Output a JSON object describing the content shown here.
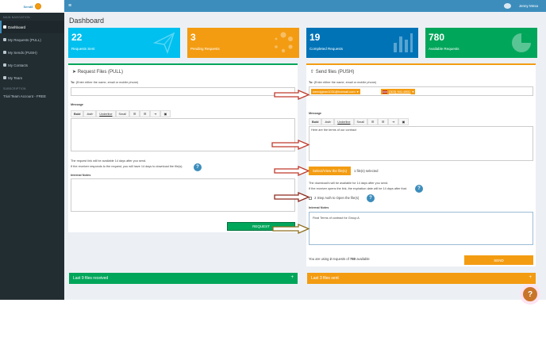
{
  "sidebar": {
    "logo": "Send8",
    "section_label": "MAIN NAVIGATION",
    "items": [
      {
        "label": "Dashboard",
        "icon": "dashboard-icon"
      },
      {
        "label": "My Requests (PULL)",
        "icon": "download-icon"
      },
      {
        "label": "My Sends (PUSH)",
        "icon": "upload-icon"
      },
      {
        "label": "My Contacts",
        "icon": "contacts-icon"
      },
      {
        "label": "My Team",
        "icon": "team-icon"
      }
    ],
    "sub_header": "SUBSCRIPTION",
    "account_label": "Trial Team Account - FREE"
  },
  "topbar": {
    "menu_icon": "≡",
    "user_name": "Jenny Mesa"
  },
  "page": {
    "title": "Dashboard"
  },
  "tiles": [
    {
      "value": "22",
      "label": "Requests Sent",
      "color": "#00c0ef",
      "icon": "paper-plane-icon"
    },
    {
      "value": "3",
      "label": "Pending Requests",
      "color": "#f39c12",
      "icon": "spinner-icon"
    },
    {
      "value": "19",
      "label": "Completed Requests",
      "color": "#0073b7",
      "icon": "bar-chart-icon"
    },
    {
      "value": "780",
      "label": "Available Requests",
      "color": "#00a65a",
      "icon": "pie-chart-icon"
    }
  ],
  "pull": {
    "title": "Request Files (PULL)",
    "to_label": "To:",
    "to_hint": "(Enter either the name, email or mobile phone)",
    "message_label": "Message",
    "toolbar": [
      "Bold",
      "Italic",
      "Underline",
      "Small"
    ],
    "note1": "The request link will be available 14 days after you send.",
    "note2": "If the receiver responds to the request, you will have 14 days to download the file(s).",
    "internal_notes_label": "Internal Notes",
    "request_button": "REQUEST"
  },
  "push": {
    "title": "Send files (PUSH)",
    "to_label": "To:",
    "to_hint": "(Enter either the name, email or mobile phone)",
    "recipient_email": "wendyjean1031@hotmail.com",
    "recipient_phone": "(303) 941-6931",
    "message_label": "Message",
    "toolbar": [
      "Bold",
      "Italic",
      "Underline",
      "Small"
    ],
    "message_text": "Here are the terms of our contract",
    "select_button": "Select/View the file(s)",
    "files_selected": "1 file(s) selected",
    "note1": "The download's will be available for 14 days after you send.",
    "note2": "If the receiver opens the link, the expiration date will be 14 days after that.",
    "two_step_label": "2 Step Auth to Open the file(s)",
    "internal_notes_label": "Internal Notes",
    "internal_notes_text": "Final Terms of contract for Group A",
    "usage_prefix": "You are using",
    "usage_used": "2",
    "usage_middle": "requests of",
    "usage_total": "780",
    "usage_suffix": "available",
    "send_button": "SEND"
  },
  "bottom": {
    "received_label": "Last 9 files received",
    "sent_label": "Last 3 files sent",
    "plus": "+"
  },
  "help_glyph": "?",
  "colors": {
    "primary": "#3c8dbc",
    "green": "#00a65a",
    "orange": "#f39c12",
    "arrow": "#c0392b"
  }
}
